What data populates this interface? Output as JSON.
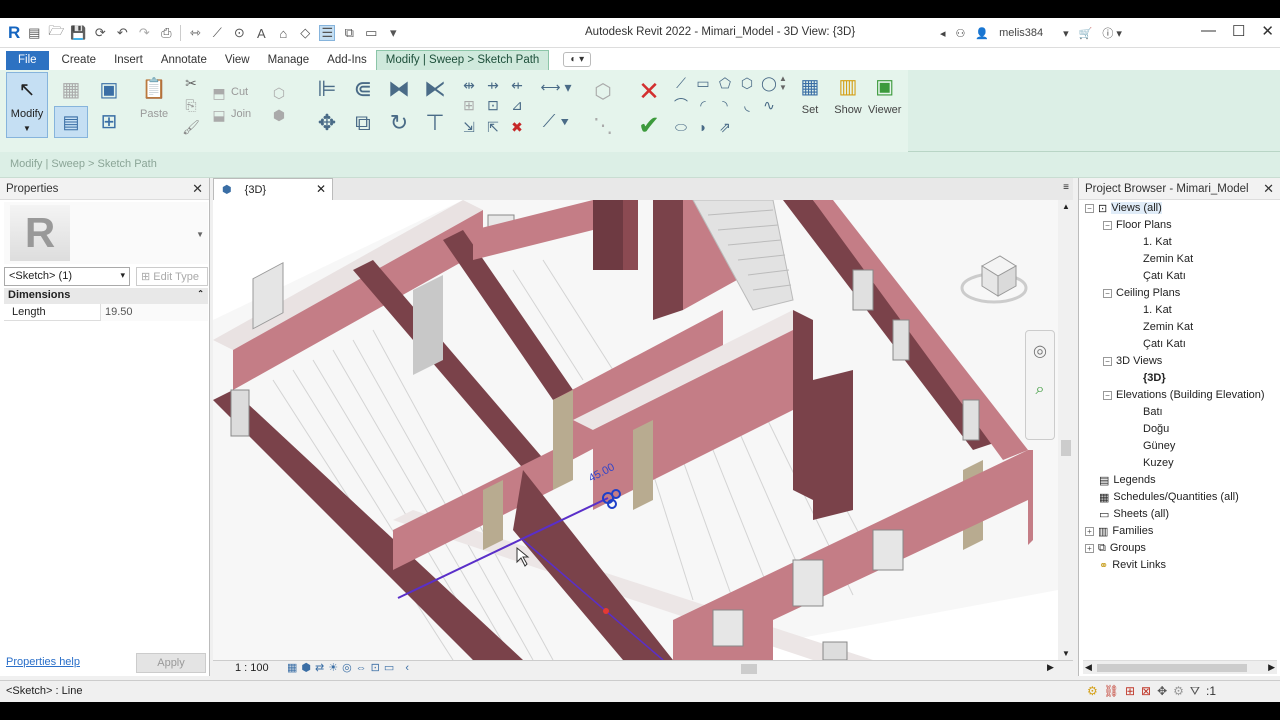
{
  "window": {
    "title": "Autodesk Revit 2022 - Mimari_Model - 3D View: {3D}",
    "user": "melis384"
  },
  "menu_tabs": [
    "File",
    "Create",
    "Insert",
    "Annotate",
    "View",
    "Manage",
    "Add-Ins",
    "Modify | Sweep > Sketch Path"
  ],
  "ribbon": {
    "modify": "Modify",
    "paste": "Paste",
    "cut": "Cut",
    "join": "Join",
    "set": "Set",
    "show": "Show",
    "viewer": "Viewer"
  },
  "panel_caption": "Modify | Sweep > Sketch Path",
  "properties": {
    "title": "Properties",
    "type_selector": "<Sketch> (1)",
    "edit_type": "Edit Type",
    "group": "Dimensions",
    "length_label": "Length",
    "length_value": "19.50",
    "help": "Properties help",
    "apply": "Apply"
  },
  "view": {
    "tab": "{3D}",
    "scale": "1 : 100",
    "angle_label": "45.00"
  },
  "project_browser": {
    "title": "Project Browser - Mimari_Model",
    "items": [
      {
        "label": "Views (all)",
        "level": 0,
        "toggle": "−"
      },
      {
        "label": "Floor Plans",
        "level": 1,
        "toggle": "−"
      },
      {
        "label": "1. Kat",
        "level": 2
      },
      {
        "label": "Zemin Kat",
        "level": 2
      },
      {
        "label": "Çatı Katı",
        "level": 2
      },
      {
        "label": "Ceiling Plans",
        "level": 1,
        "toggle": "−"
      },
      {
        "label": "1. Kat",
        "level": 2
      },
      {
        "label": "Zemin Kat",
        "level": 2
      },
      {
        "label": "Çatı Katı",
        "level": 2
      },
      {
        "label": "3D Views",
        "level": 1,
        "toggle": "−"
      },
      {
        "label": "{3D}",
        "level": 2,
        "bold": true
      },
      {
        "label": "Elevations (Building Elevation)",
        "level": 1,
        "toggle": "−"
      },
      {
        "label": "Batı",
        "level": 2
      },
      {
        "label": "Doğu",
        "level": 2
      },
      {
        "label": "Güney",
        "level": 2
      },
      {
        "label": "Kuzey",
        "level": 2
      },
      {
        "label": "Legends",
        "level": 0
      },
      {
        "label": "Schedules/Quantities (all)",
        "level": 0
      },
      {
        "label": "Sheets (all)",
        "level": 0
      },
      {
        "label": "Families",
        "level": 0,
        "toggle": "+"
      },
      {
        "label": "Groups",
        "level": 0,
        "toggle": "+"
      },
      {
        "label": "Revit Links",
        "level": 0
      }
    ]
  },
  "status": {
    "text": "<Sketch> : Line",
    "filter_count": ":1"
  },
  "colors": {
    "wall": "#b5727a",
    "wall_dark": "#6e3a42",
    "accent": "#2d72c2",
    "ribbon": "#dcefe6"
  }
}
